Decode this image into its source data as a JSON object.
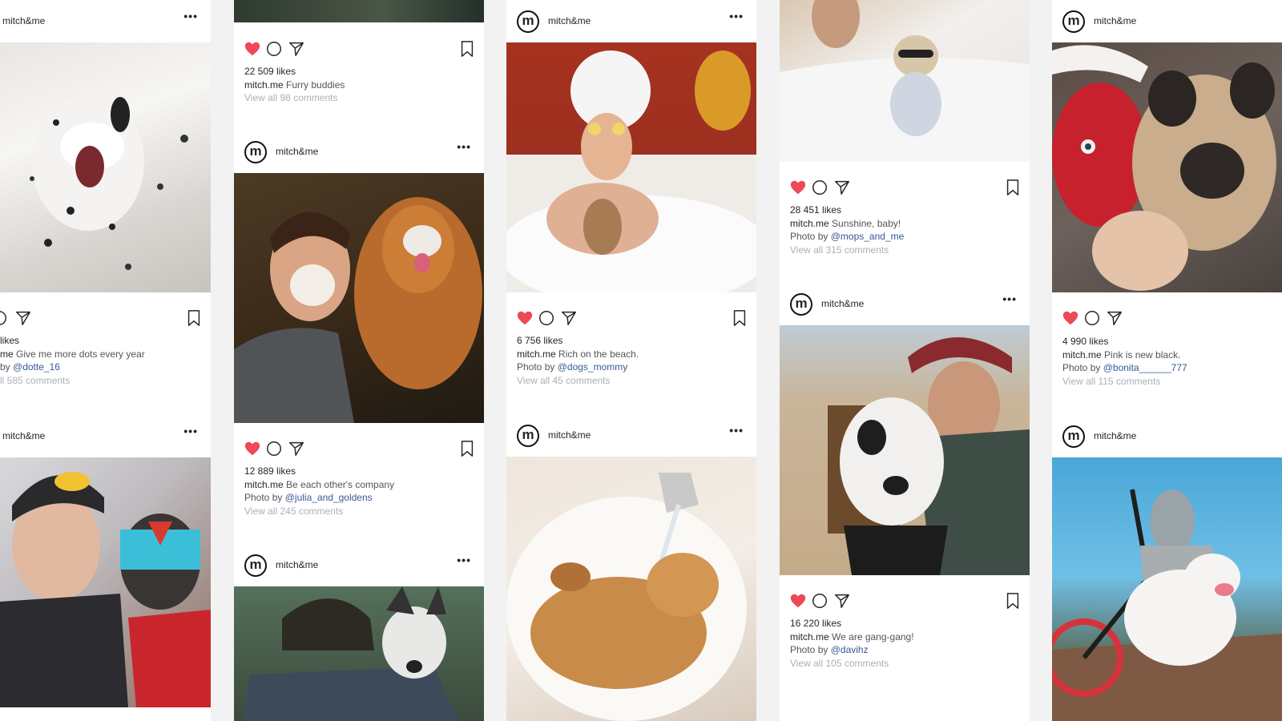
{
  "brand": {
    "logo_letter": "m",
    "username": "mitch&me",
    "caption_user": "mitch.me",
    "more": "•••",
    "photo_by": "Photo by"
  },
  "colors": {
    "heart": "#ed4956",
    "mention": "#385898",
    "comments": "#aab0b6"
  },
  "icons": [
    "heart-icon",
    "comment-icon",
    "share-icon",
    "bookmark-icon",
    "more-icon"
  ],
  "posts": [
    {
      "likes": "likes",
      "caption": "Give me more dots every year",
      "photo_by": "by",
      "mention": "@dotte_16",
      "comments": "ll 585 comments",
      "photo": "dalmatian puppy yawning"
    },
    {
      "photo": "girl in batman hat with dog in superhero mask"
    },
    {
      "likes": "22 509 likes",
      "caption": "Furry buddies",
      "comments": "View all 98 comments"
    },
    {
      "likes": "12 889 likes",
      "caption": "Be each other's company",
      "mention": "@julia_and_goldens",
      "comments": "View all 245 comments",
      "photo": "man and golden retriever with cream on faces"
    },
    {
      "photo": "man carrying husky on his back"
    },
    {
      "likes": "6 756 likes",
      "caption": "Rich on the beach.",
      "mention": "@dogs_mommy",
      "comments": "View all 45 comments",
      "photo": "woman in bubble bath with small dog"
    },
    {
      "photo": "golden puppy sleeping in sink"
    },
    {
      "likes": "28 451 likes",
      "caption": "Sunshine, baby!",
      "mention": "@mops_and_me",
      "comments": "View all 315 comments",
      "photo": "pug in bathrobe on bed"
    },
    {
      "likes": "16 220 likes",
      "caption": "We are gang-gang!",
      "mention": "@davihz",
      "comments": "View all 105 comments",
      "photo": "man with cap and white pitbull"
    },
    {
      "likes": "4 990 likes",
      "caption": "Pink is new black.",
      "mention": "@bonita______777",
      "comments": "View all 115 comments",
      "photo": "woman in face mask with french bulldog"
    },
    {
      "photo": "girl on bicycle with bull terrier"
    }
  ]
}
